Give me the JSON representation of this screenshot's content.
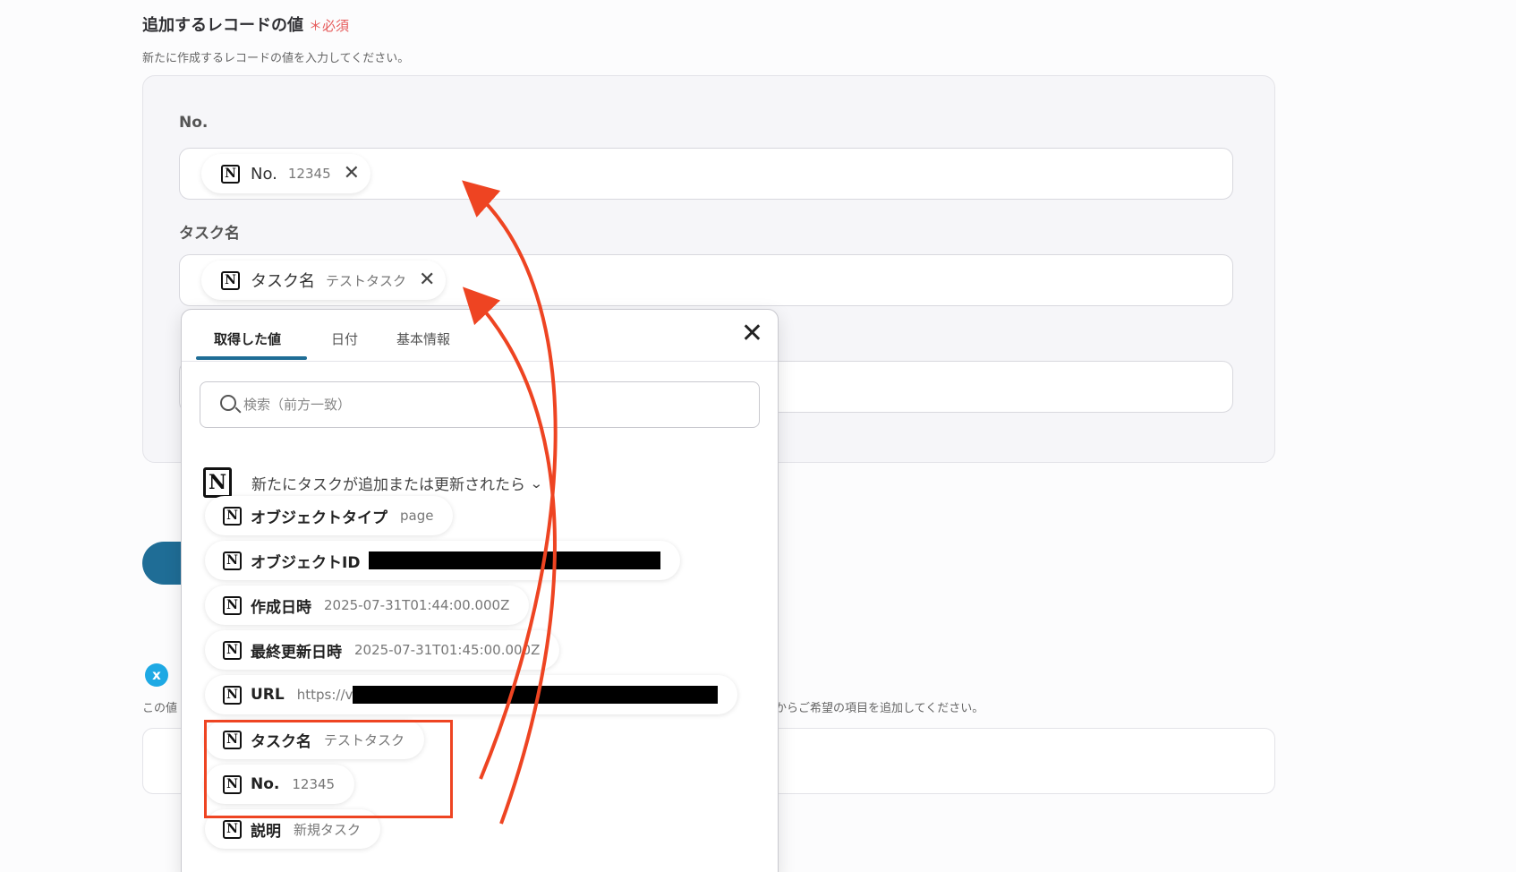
{
  "section": {
    "title": "追加するレコードの値",
    "required": "＊必須",
    "description": "新たに作成するレコードの値を入力してください。"
  },
  "fields": [
    {
      "label": "No.",
      "chip": {
        "label": "No.",
        "value": "12345",
        "icon": "notion-icon"
      }
    },
    {
      "label": "タスク名",
      "chip": {
        "label": "タスク名",
        "value": "テストタスク",
        "icon": "notion-icon"
      }
    }
  ],
  "popup": {
    "tabs": [
      {
        "label": "取得した値",
        "active": true
      },
      {
        "label": "日付",
        "active": false
      },
      {
        "label": "基本情報",
        "active": false
      }
    ],
    "search_placeholder": "検索（前方一致）",
    "group_title": "新たにタスクが追加または更新されたら",
    "items": [
      {
        "label": "オブジェクトタイプ",
        "value": "page"
      },
      {
        "label": "オブジェクトID",
        "value": ""
      },
      {
        "label": "作成日時",
        "value": "2025-07-31T01:44:00.000Z"
      },
      {
        "label": "最終更新日時",
        "value": "2025-07-31T01:45:00.000Z"
      },
      {
        "label": "URL",
        "value": "https://v"
      },
      {
        "label": "タスク名",
        "value": "テストタスク"
      },
      {
        "label": "No.",
        "value": "12345"
      },
      {
        "label": "説明",
        "value": "新規タスク"
      }
    ]
  },
  "bottom": {
    "badge_icon": "x",
    "heading_fragment": "",
    "desc_left": "この値",
    "desc_right": "からご希望の項目を追加してください。"
  },
  "colors": {
    "accent": "#1f6d96",
    "annotation": "#ee4422",
    "required": "#e65c5c"
  }
}
